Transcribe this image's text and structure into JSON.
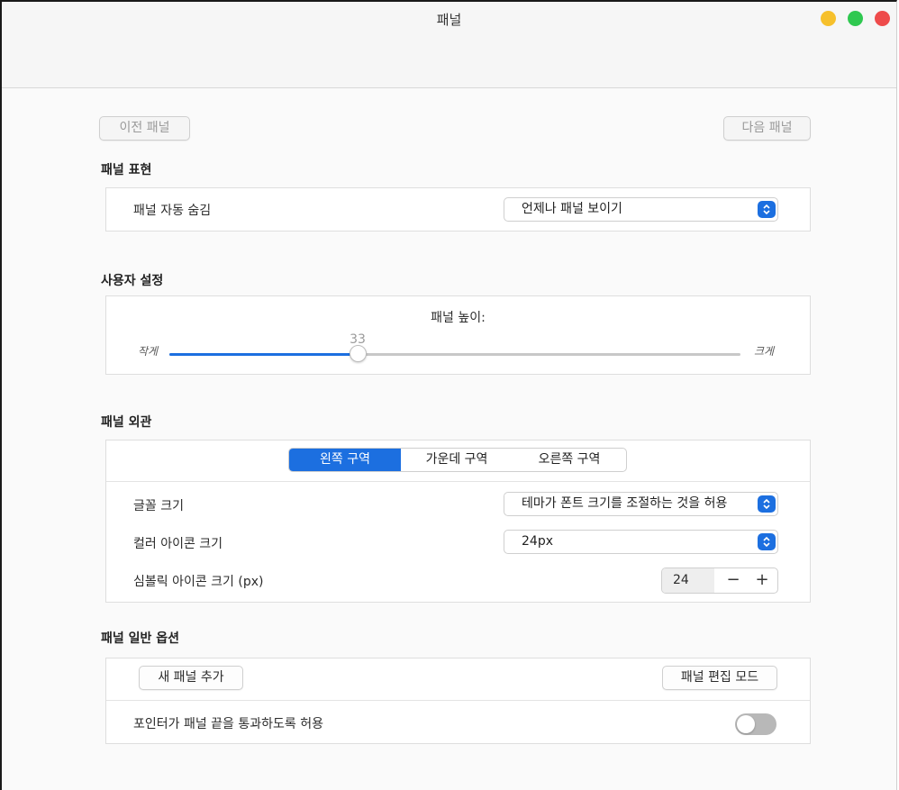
{
  "window": {
    "title": "패널"
  },
  "nav": {
    "prev_label": "이전 패널",
    "next_label": "다음 패널"
  },
  "section_representation": {
    "title": "패널 표현",
    "autohide_label": "패널 자동 숨김",
    "autohide_value": "언제나 패널 보이기"
  },
  "section_user": {
    "title": "사용자 설정",
    "height_label": "패널 높이:",
    "height_value": "33",
    "height_fraction": 0.33,
    "min_label": "작게",
    "max_label": "크게"
  },
  "section_appearance": {
    "title": "패널 외관",
    "tabs": [
      {
        "label": "왼쪽 구역",
        "active": true
      },
      {
        "label": "가운데 구역",
        "active": false
      },
      {
        "label": "오른쪽 구역",
        "active": false
      }
    ],
    "font_size_label": "글꼴 크기",
    "font_size_value": "테마가 폰트 크기를 조절하는 것을 허용",
    "color_icon_label": "컬러 아이콘 크기",
    "color_icon_value": "24px",
    "symbolic_icon_label": "심볼릭 아이콘 크기 (px)",
    "symbolic_icon_value": "24",
    "minus": "−",
    "plus": "+"
  },
  "section_general": {
    "title": "패널 일반 옵션",
    "add_panel_label": "새 패널 추가",
    "edit_mode_label": "패널 편집 모드",
    "pointer_label": "포인터가 패널 끝을 통과하도록 허용",
    "pointer_enabled": false
  },
  "colors": {
    "accent": "#1c6fe0",
    "close": "#ee4b4b",
    "minimize": "#f6c02c",
    "maximize": "#2fc850"
  }
}
